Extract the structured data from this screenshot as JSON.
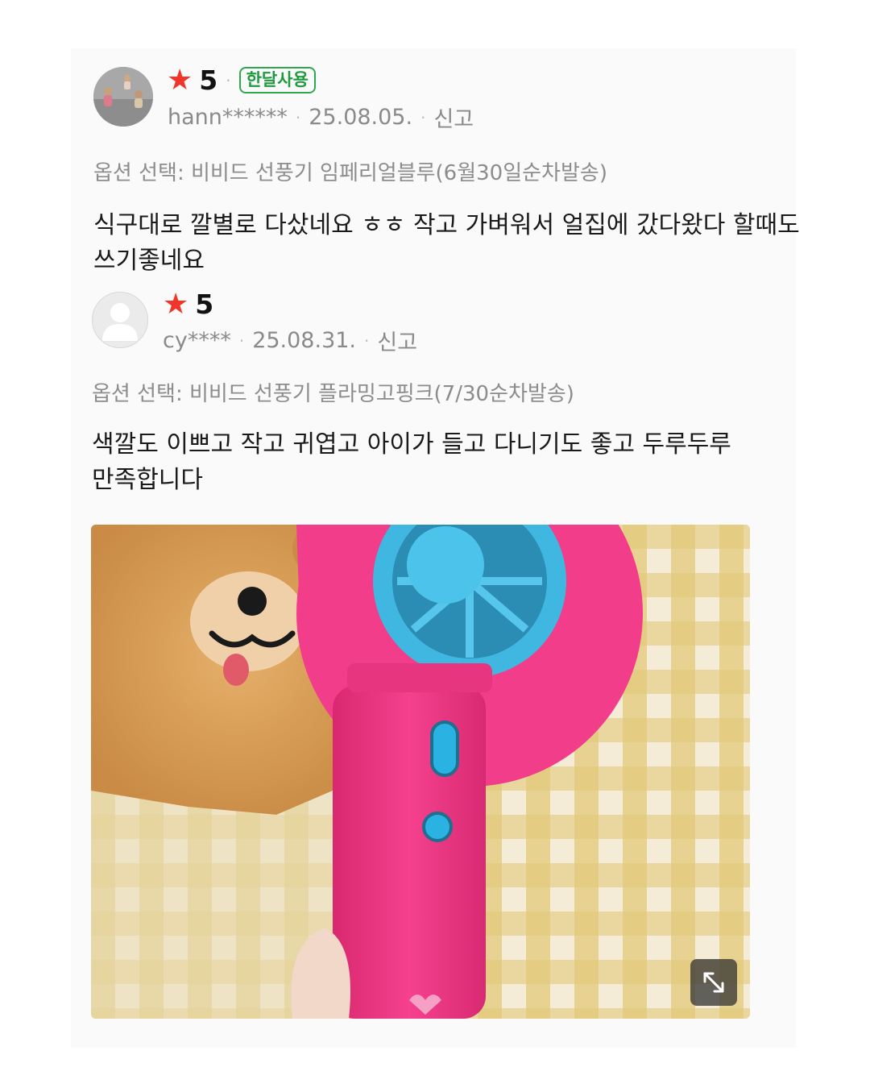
{
  "reviews": [
    {
      "rating": "5",
      "badge": "한달사용",
      "username": "hann******",
      "date": "25.08.05.",
      "report_label": "신고",
      "option": "옵션 선택: 비비드 선풍기 임페리얼블루(6월30일순차발송)",
      "text": "식구대로 깔별로 다샀네요 ㅎㅎ 작고 가벼워서 얼집에 갔다왔다 할때도\n쓰기좋네요"
    },
    {
      "rating": "5",
      "username": "cy****",
      "date": "25.08.31.",
      "report_label": "신고",
      "option": "옵션 선택: 비비드 선풍기 플라밍고핑크(7/30순차발송)",
      "text": "색깔도 이쁘고 작고 귀엽고 아이가 들고 다니기도 좋고 두루두루\n만족합니다"
    }
  ],
  "icons": {
    "star": "star-icon",
    "expand": "expand-icon",
    "avatar_default": "person-silhouette-icon"
  },
  "colors": {
    "star": "#f0362b",
    "badge": "#1f9a3f",
    "meta_text": "#8a8a8a",
    "fan_pink": "#f23d8a",
    "fan_blue": "#3fb7e0"
  }
}
